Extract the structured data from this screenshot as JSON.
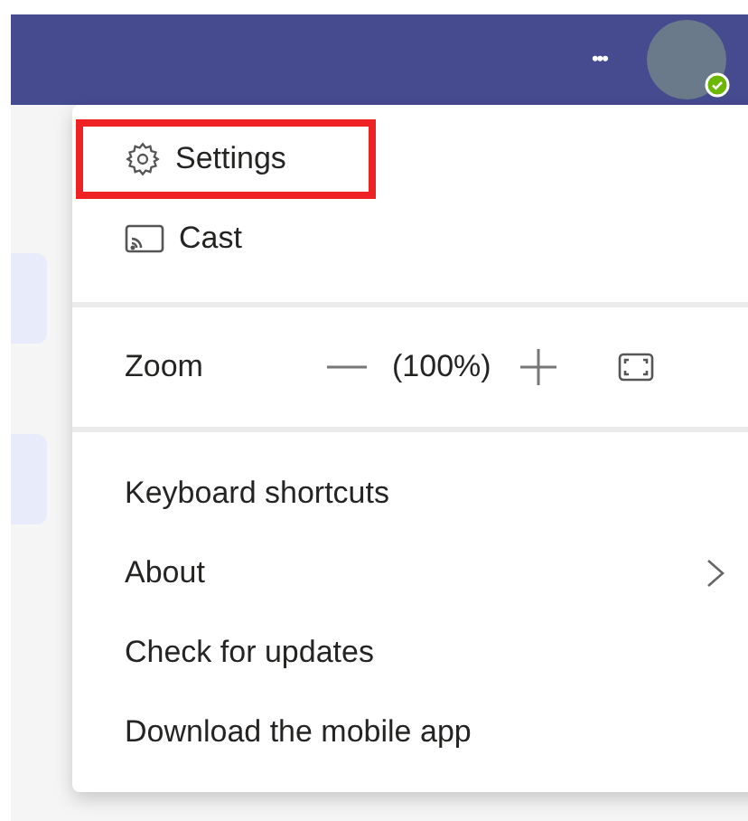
{
  "header": {
    "more_label": "•••"
  },
  "menu": {
    "top_items": [
      {
        "label": "Settings",
        "kind": "gear",
        "highlighted": true
      },
      {
        "label": "Cast",
        "kind": "cast",
        "highlighted": false
      }
    ],
    "zoom": {
      "label": "Zoom",
      "value": "(100%)"
    },
    "bottom_items": [
      {
        "label": "Keyboard shortcuts",
        "has_submenu": false
      },
      {
        "label": "About",
        "has_submenu": true
      },
      {
        "label": "Check for updates",
        "has_submenu": false
      },
      {
        "label": "Download the mobile app",
        "has_submenu": false
      }
    ]
  }
}
